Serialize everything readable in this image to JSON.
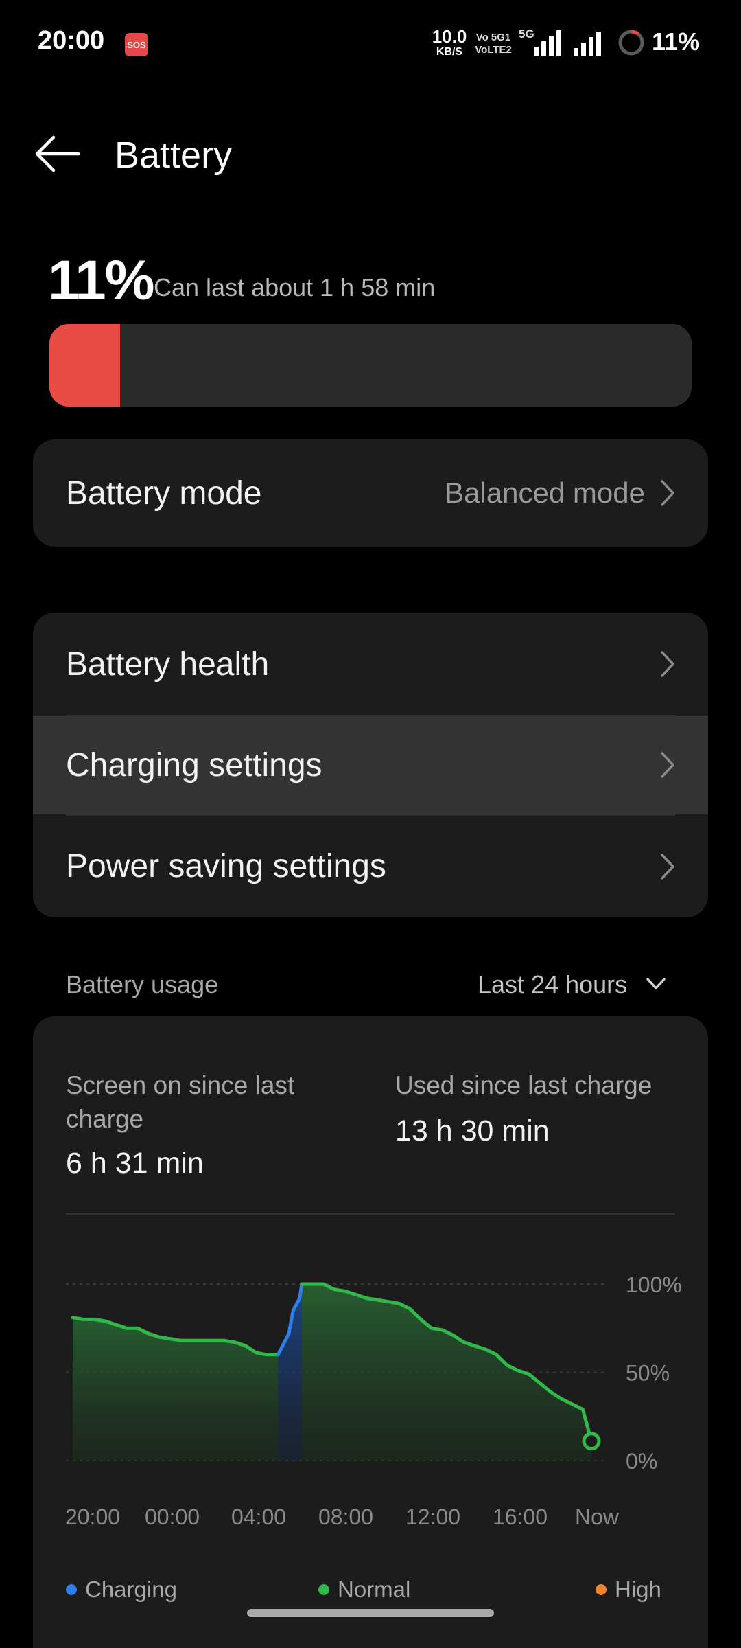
{
  "status_bar": {
    "time": "20:00",
    "sos": "SOS",
    "net_speed_value": "10.0",
    "net_speed_unit": "KB/S",
    "volte_line1": "Vo 5G1",
    "volte_line2": "VoLTE2",
    "fiveg": "5G",
    "battery": "11%"
  },
  "header": {
    "title": "Battery"
  },
  "summary": {
    "percent": "11%",
    "level": 0.11,
    "estimate": "Can last about 1 h 58 min",
    "fill_color": "#e84a44"
  },
  "battery_mode": {
    "label": "Battery mode",
    "value": "Balanced mode"
  },
  "settings_list": {
    "items": [
      {
        "label": "Battery health"
      },
      {
        "label": "Charging settings"
      },
      {
        "label": "Power saving settings"
      }
    ]
  },
  "usage": {
    "title": "Battery usage",
    "period": "Last 24 hours",
    "screen_on_label": "Screen on since last charge",
    "screen_on_value": "6 h 31 min",
    "used_label": "Used since last charge",
    "used_value": "13 h 30 min",
    "legend": [
      {
        "label": "Charging",
        "color": "#2f7fe8"
      },
      {
        "label": "Normal",
        "color": "#32b84a"
      },
      {
        "label": "High",
        "color": "#f0832c"
      }
    ]
  },
  "chart_data": {
    "type": "area",
    "y_tick_labels": [
      "100%",
      "50%",
      "0%"
    ],
    "x_tick_labels": [
      "20:00",
      "00:00",
      "04:00",
      "08:00",
      "12:00",
      "16:00",
      "Now"
    ],
    "ylim": [
      0,
      100
    ],
    "xlim_hours": [
      0,
      24
    ],
    "grid": true,
    "series": [
      {
        "name": "Normal",
        "color": "#32b84a",
        "points": [
          [
            0.0,
            81
          ],
          [
            0.5,
            80
          ],
          [
            1.0,
            80
          ],
          [
            1.5,
            79
          ],
          [
            2.0,
            77
          ],
          [
            2.5,
            75
          ],
          [
            3.0,
            75
          ],
          [
            3.5,
            72
          ],
          [
            4.0,
            70
          ],
          [
            5.0,
            68
          ],
          [
            6.0,
            68
          ],
          [
            7.0,
            68
          ],
          [
            7.5,
            67
          ],
          [
            8.0,
            65
          ],
          [
            8.5,
            61
          ],
          [
            9.0,
            60
          ],
          [
            9.5,
            60
          ]
        ]
      },
      {
        "name": "Charging",
        "color": "#2f7fe8",
        "points": [
          [
            9.5,
            60
          ],
          [
            10.0,
            72
          ],
          [
            10.2,
            85
          ],
          [
            10.5,
            92
          ],
          [
            10.6,
            100
          ]
        ]
      },
      {
        "name": "Normal",
        "color": "#32b84a",
        "points": [
          [
            10.6,
            100
          ],
          [
            11.6,
            100
          ],
          [
            12.1,
            97
          ],
          [
            12.6,
            96
          ],
          [
            13.1,
            94
          ],
          [
            13.6,
            92
          ],
          [
            14.1,
            91
          ],
          [
            14.6,
            90
          ],
          [
            15.1,
            89
          ],
          [
            15.6,
            86
          ],
          [
            16.1,
            80
          ],
          [
            16.6,
            75
          ],
          [
            17.1,
            74
          ],
          [
            17.6,
            71
          ],
          [
            18.1,
            67
          ],
          [
            18.6,
            65
          ],
          [
            19.1,
            63
          ],
          [
            19.6,
            60
          ],
          [
            20.1,
            54
          ],
          [
            20.6,
            51
          ],
          [
            21.1,
            49
          ],
          [
            21.6,
            44
          ],
          [
            22.1,
            39
          ],
          [
            22.6,
            35
          ],
          [
            23.1,
            32
          ],
          [
            23.6,
            29
          ],
          [
            24.0,
            11
          ]
        ]
      }
    ]
  }
}
